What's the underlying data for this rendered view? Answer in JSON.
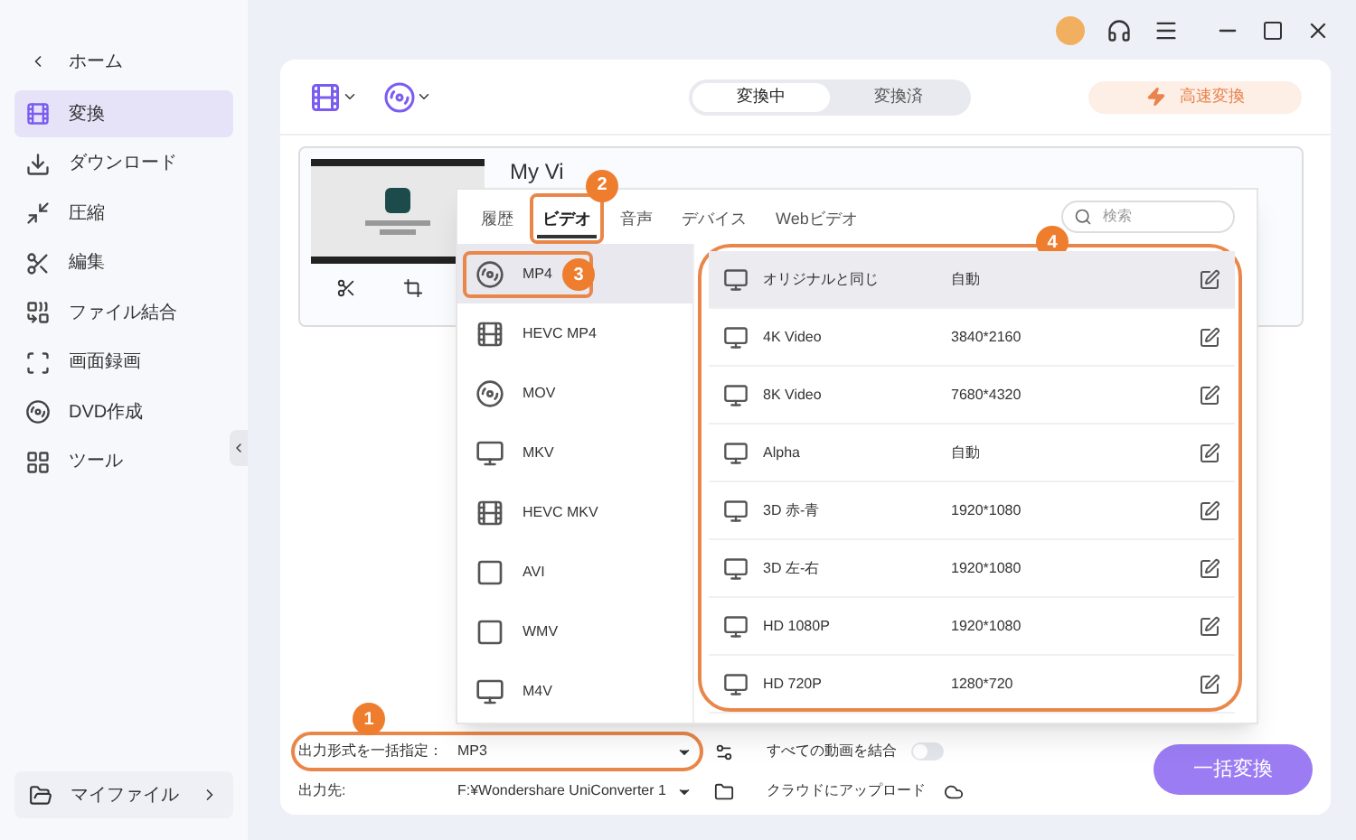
{
  "sidebar": {
    "home": "ホーム",
    "items": [
      {
        "label": "変換",
        "kind": "convert",
        "selected": true
      },
      {
        "label": "ダウンロード",
        "kind": "download",
        "selected": false
      },
      {
        "label": "圧縮",
        "kind": "compress",
        "selected": false
      },
      {
        "label": "編集",
        "kind": "edit",
        "selected": false
      },
      {
        "label": "ファイル結合",
        "kind": "merge",
        "selected": false
      },
      {
        "label": "画面録画",
        "kind": "record",
        "selected": false
      },
      {
        "label": "DVD作成",
        "kind": "dvd",
        "selected": false
      },
      {
        "label": "ツール",
        "kind": "tools",
        "selected": false
      }
    ],
    "footer": "マイファイル"
  },
  "toolbar": {
    "tabs": [
      {
        "label": "変換中",
        "selected": true
      },
      {
        "label": "変換済",
        "selected": false
      }
    ],
    "fast_button": "高速変換"
  },
  "file_card": {
    "title": "My Vi"
  },
  "format_popup": {
    "tabs": [
      {
        "label": "履歴",
        "selected": false
      },
      {
        "label": "ビデオ",
        "selected": true,
        "callout": "2"
      },
      {
        "label": "音声",
        "selected": false
      },
      {
        "label": "デバイス",
        "selected": false
      },
      {
        "label": "Webビデオ",
        "selected": false
      }
    ],
    "search": {
      "placeholder": "検索"
    },
    "formats": [
      {
        "label": "MP4",
        "kind": "disc",
        "selected": true,
        "callout": "3"
      },
      {
        "label": "HEVC MP4",
        "kind": "hevc",
        "selected": false
      },
      {
        "label": "MOV",
        "kind": "disc",
        "selected": false
      },
      {
        "label": "MKV",
        "kind": "screen",
        "selected": false
      },
      {
        "label": "HEVC MKV",
        "kind": "hevc",
        "selected": false
      },
      {
        "label": "AVI",
        "kind": "window",
        "selected": false
      },
      {
        "label": "WMV",
        "kind": "window",
        "selected": false
      },
      {
        "label": "M4V",
        "kind": "screen",
        "selected": false
      }
    ],
    "presets_callout": "4",
    "presets": [
      {
        "name": "オリジナルと同じ",
        "resolution": "自動",
        "selected": true
      },
      {
        "name": "4K Video",
        "resolution": "3840*2160",
        "selected": false
      },
      {
        "name": "8K Video",
        "resolution": "7680*4320",
        "selected": false
      },
      {
        "name": "Alpha",
        "resolution": "自動",
        "selected": false
      },
      {
        "name": "3D 赤-青",
        "resolution": "1920*1080",
        "selected": false
      },
      {
        "name": "3D 左-右",
        "resolution": "1920*1080",
        "selected": false
      },
      {
        "name": "HD 1080P",
        "resolution": "1920*1080",
        "selected": false
      },
      {
        "name": "HD 720P",
        "resolution": "1280*720",
        "selected": false
      }
    ]
  },
  "bottom": {
    "format_label": "出力形式を一括指定：",
    "format_value": "MP3",
    "format_callout": "1",
    "merge_label": "すべての動画を結合",
    "merge_on": false,
    "output_label": "出力先:",
    "output_value": "F:¥Wondershare UniConverter 1",
    "cloud_label": "クラウドにアップロード",
    "convert_button": "一括変換"
  }
}
